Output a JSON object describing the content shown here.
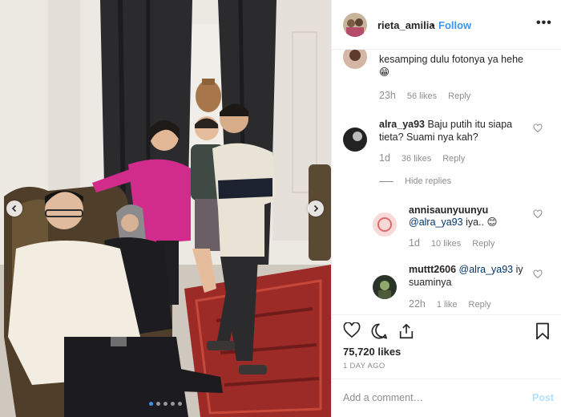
{
  "header": {
    "username": "rieta_amilia",
    "separator": "•",
    "follow_label": "Follow",
    "more_label": "•••"
  },
  "comments": {
    "partial": {
      "text_line1": "kesamping dulu fotonya ya hehe",
      "emoji": "😁",
      "time": "23h",
      "likes": "56 likes",
      "reply_label": "Reply"
    },
    "main": {
      "username": "alra_ya93",
      "text_line1": "Baju putih itu siapa",
      "text_line2": "tieta? Suami nya kah?",
      "time": "1d",
      "likes": "36 likes",
      "reply_label": "Reply",
      "hide_replies_label": "Hide replies"
    },
    "replies": [
      {
        "username": "annisaunyuunyu",
        "mention": "@alra_ya93",
        "text": " iya..",
        "emoji": "😊",
        "time": "1d",
        "likes": "10 likes",
        "reply_label": "Reply"
      },
      {
        "username": "muttt2606",
        "mention": "@alra_ya93",
        "text_line1": " iy",
        "text_line2": "suaminya",
        "time": "22h",
        "likes": "1 like",
        "reply_label": "Reply"
      }
    ]
  },
  "post": {
    "likes": "75,720 likes",
    "time_ago": "1 DAY AGO"
  },
  "comment_form": {
    "placeholder": "Add a comment…",
    "post_label": "Post"
  },
  "carousel": {
    "dot_count": 5,
    "active_index": 0
  },
  "colors": {
    "link_blue": "#3897f0",
    "muted": "#8e8e8e",
    "post_disabled": "#b2dffc",
    "text": "#262626",
    "border": "#efefef"
  },
  "icons": {
    "heart": "heart-icon",
    "comment": "comment-icon",
    "share": "share-icon",
    "bookmark": "bookmark-icon",
    "prev": "chevron-left-icon",
    "next": "chevron-right-icon"
  }
}
